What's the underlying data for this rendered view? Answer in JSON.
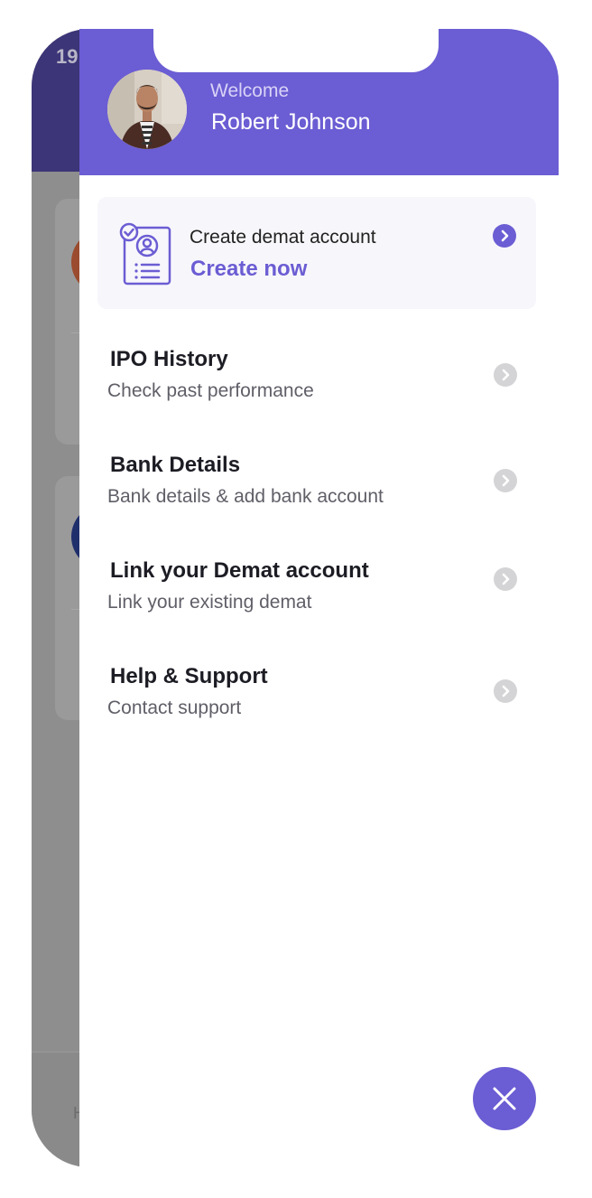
{
  "background": {
    "status_time": "19:",
    "tab_label": "H"
  },
  "drawer": {
    "welcome": "Welcome",
    "user_name": "Robert Johnson",
    "cta": {
      "title": "Create demat account",
      "link": "Create now"
    },
    "menu": [
      {
        "title": "IPO History",
        "subtitle": "Check past performance"
      },
      {
        "title": "Bank Details",
        "subtitle": "Bank details & add bank account"
      },
      {
        "title": "Link your Demat account",
        "subtitle": "Link your existing demat"
      },
      {
        "title": "Help & Support",
        "subtitle": "Contact support"
      }
    ]
  },
  "colors": {
    "accent": "#6b5dd3",
    "background_header": "#3c3577",
    "overlay": "#8e8e8e",
    "chevron_inactive": "#d4d4d6"
  },
  "icons": {
    "cta": "account-document-icon",
    "chevron": "chevron-right-icon",
    "close": "close-icon"
  }
}
